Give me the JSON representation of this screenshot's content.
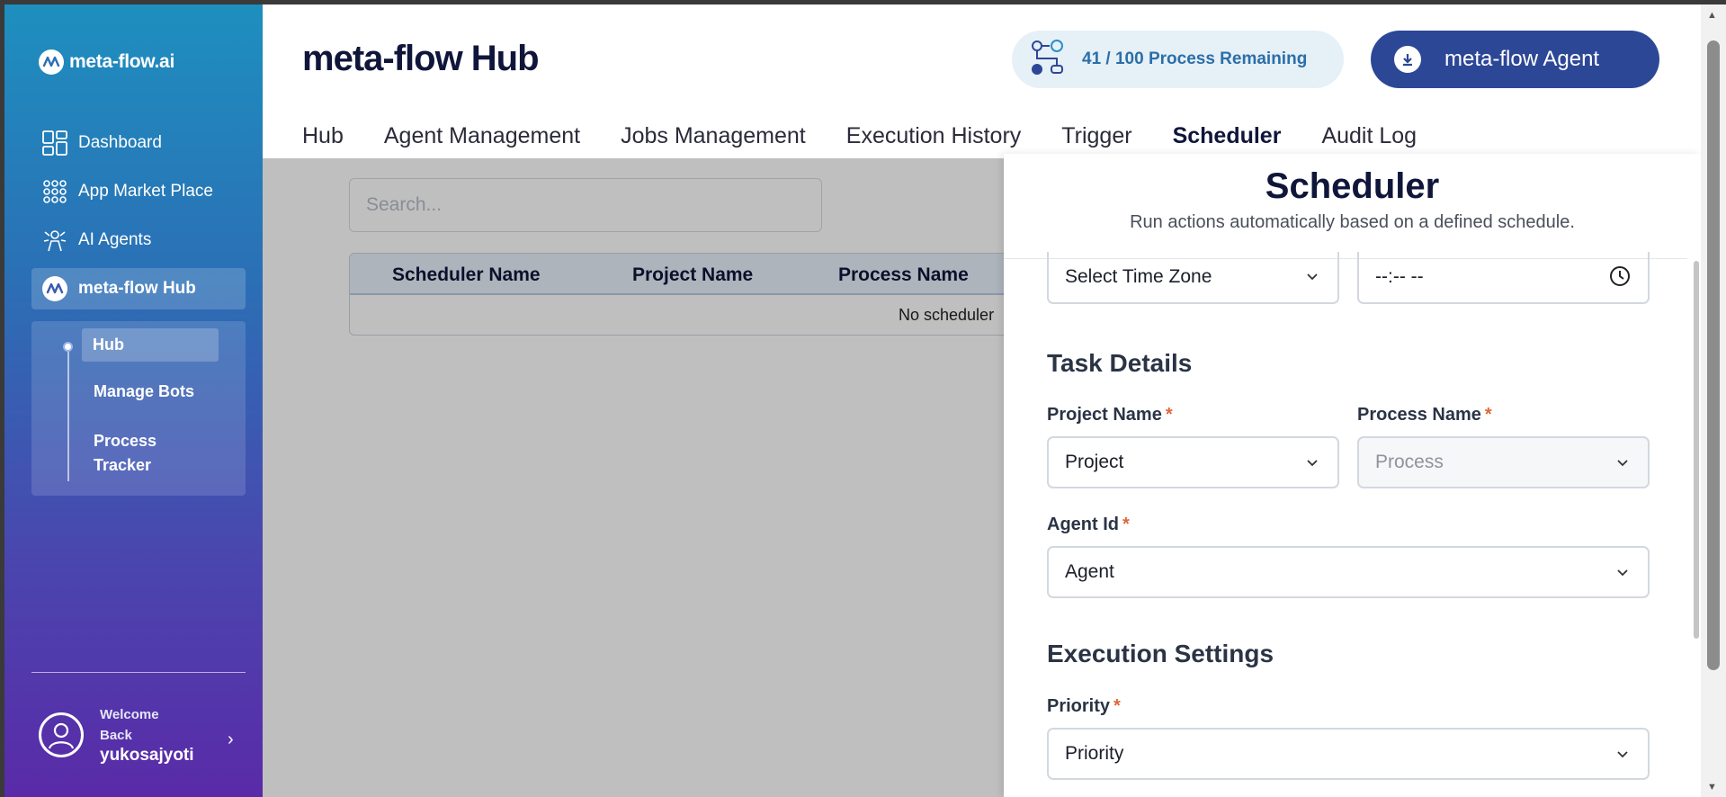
{
  "sidebar": {
    "logo_text": "meta-flow.ai",
    "items": [
      {
        "label": "Dashboard"
      },
      {
        "label": "App Market Place"
      },
      {
        "label": "AI Agents"
      },
      {
        "label": "meta-flow Hub"
      }
    ],
    "submenu": [
      {
        "label": "Hub"
      },
      {
        "label": "Manage Bots"
      },
      {
        "label": "Process"
      },
      {
        "label": "Tracker"
      }
    ],
    "user": {
      "welcome_1": "Welcome",
      "welcome_2": "Back",
      "name": "yukosajyoti"
    }
  },
  "header": {
    "title": "meta-flow Hub",
    "quota": "41 / 100 Process Remaining",
    "agent_button": "meta-flow Agent",
    "tabs": [
      {
        "label": "Hub"
      },
      {
        "label": "Agent Management"
      },
      {
        "label": "Jobs Management"
      },
      {
        "label": "Execution History"
      },
      {
        "label": "Trigger"
      },
      {
        "label": "Scheduler"
      },
      {
        "label": "Audit Log"
      }
    ]
  },
  "main": {
    "search_placeholder": "Search...",
    "columns": [
      "Scheduler Name",
      "Project Name",
      "Process Name"
    ],
    "empty_text": "No scheduler"
  },
  "drawer": {
    "title": "Scheduler",
    "subtitle": "Run actions automatically based on a defined schedule.",
    "timezone": "Select Time Zone",
    "time": "--:-- --",
    "task_section": "Task Details",
    "project_label": "Project Name",
    "project_value": "Project",
    "process_label": "Process Name",
    "process_value": "Process",
    "agent_label": "Agent Id",
    "agent_value": "Agent",
    "exec_section": "Execution Settings",
    "priority_label": "Priority",
    "priority_value": "Priority",
    "required_mark": "*"
  },
  "colors": {
    "primary": "#2d4797",
    "accent": "#2b6fa8",
    "required": "#e0673a"
  }
}
